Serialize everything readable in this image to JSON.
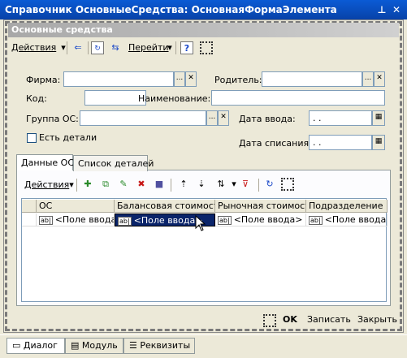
{
  "window": {
    "title": "Справочник ОсновныеСредства: ОсновнаяФормаЭлемента",
    "pin_icon": "pin-icon",
    "close_icon": "close-icon"
  },
  "form": {
    "header": "Основные средства",
    "toolbar": {
      "actions_label": "Действия",
      "goto_label": "Перейти"
    }
  },
  "fields": {
    "firma_label": "Фирма:",
    "firma_value": "",
    "parent_label": "Родитель:",
    "parent_value": "",
    "code_label": "Код:",
    "code_value": "",
    "name_label": "Наименование:",
    "name_value": "",
    "group_label": "Группа ОС:",
    "group_value": "",
    "date_in_label": "Дата ввода:",
    "date_in_value": " .  .",
    "has_details_label": "Есть детали",
    "date_out_label": "Дата списания:",
    "date_out_value": " .  ."
  },
  "tabs": [
    {
      "label": "Данные ОС",
      "active": true
    },
    {
      "label": "Список деталей",
      "active": false
    }
  ],
  "tab_toolbar": {
    "actions_label": "Действия"
  },
  "table": {
    "columns": [
      "ОС",
      "Балансовая стоимость",
      "Рыночная стоимость",
      "Подразделение"
    ],
    "row": [
      "<Поле ввода>",
      "<Поле ввода>",
      "<Поле ввода>",
      "<Поле ввода>"
    ],
    "input_badge": "ab|"
  },
  "bottom": {
    "ok_label": "OK",
    "save_label": "Записать",
    "close_label": "Закрыть"
  },
  "status_tabs": [
    {
      "label": "Диалог",
      "active": true
    },
    {
      "label": "Модуль",
      "active": false
    },
    {
      "label": "Реквизиты",
      "active": false
    }
  ]
}
